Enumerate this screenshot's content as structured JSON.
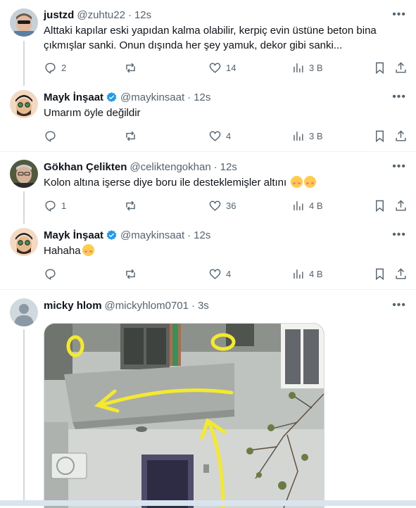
{
  "tweets": [
    {
      "name": "justzd",
      "handle": "@zuhtu22",
      "time": "12s",
      "text": "Alttaki kapılar eski yapıdan kalma olabilir, kerpiç evin üstüne beton bina çıkmışlar sanki. Onun dışında her şey yamuk, dekor gibi sanki...",
      "replies": "2",
      "reposts": "",
      "likes": "14",
      "views": "3 B"
    },
    {
      "name": "Mayk İnşaat",
      "handle": "@maykinsaat",
      "time": "12s",
      "text": "Umarım öyle değildir",
      "replies": "",
      "reposts": "",
      "likes": "4",
      "views": "3 B"
    },
    {
      "name": "Gökhan Çelikten",
      "handle": "@celiktengokhan",
      "time": "12s",
      "text": "Kolon altına işerse diye boru ile desteklemişler altını",
      "replies": "1",
      "reposts": "",
      "likes": "36",
      "views": "4 B"
    },
    {
      "name": "Mayk İnşaat",
      "handle": "@maykinsaat",
      "time": "12s",
      "text": "Hahaha",
      "replies": "",
      "reposts": "",
      "likes": "4",
      "views": "4 B"
    },
    {
      "name": "micky hlom",
      "handle": "@mickyhlom0701",
      "time": "3s",
      "text": ""
    }
  ],
  "icons": {
    "reply": "reply-icon",
    "repost": "repost-icon",
    "like": "heart-icon",
    "views": "views-icon",
    "bookmark": "bookmark-icon",
    "share": "share-icon",
    "more": "more-icon",
    "verified": "verified-badge-icon"
  },
  "colors": {
    "accent": "#1d9bf0",
    "secondary_text": "#536471",
    "annotation": "#f5e930"
  }
}
